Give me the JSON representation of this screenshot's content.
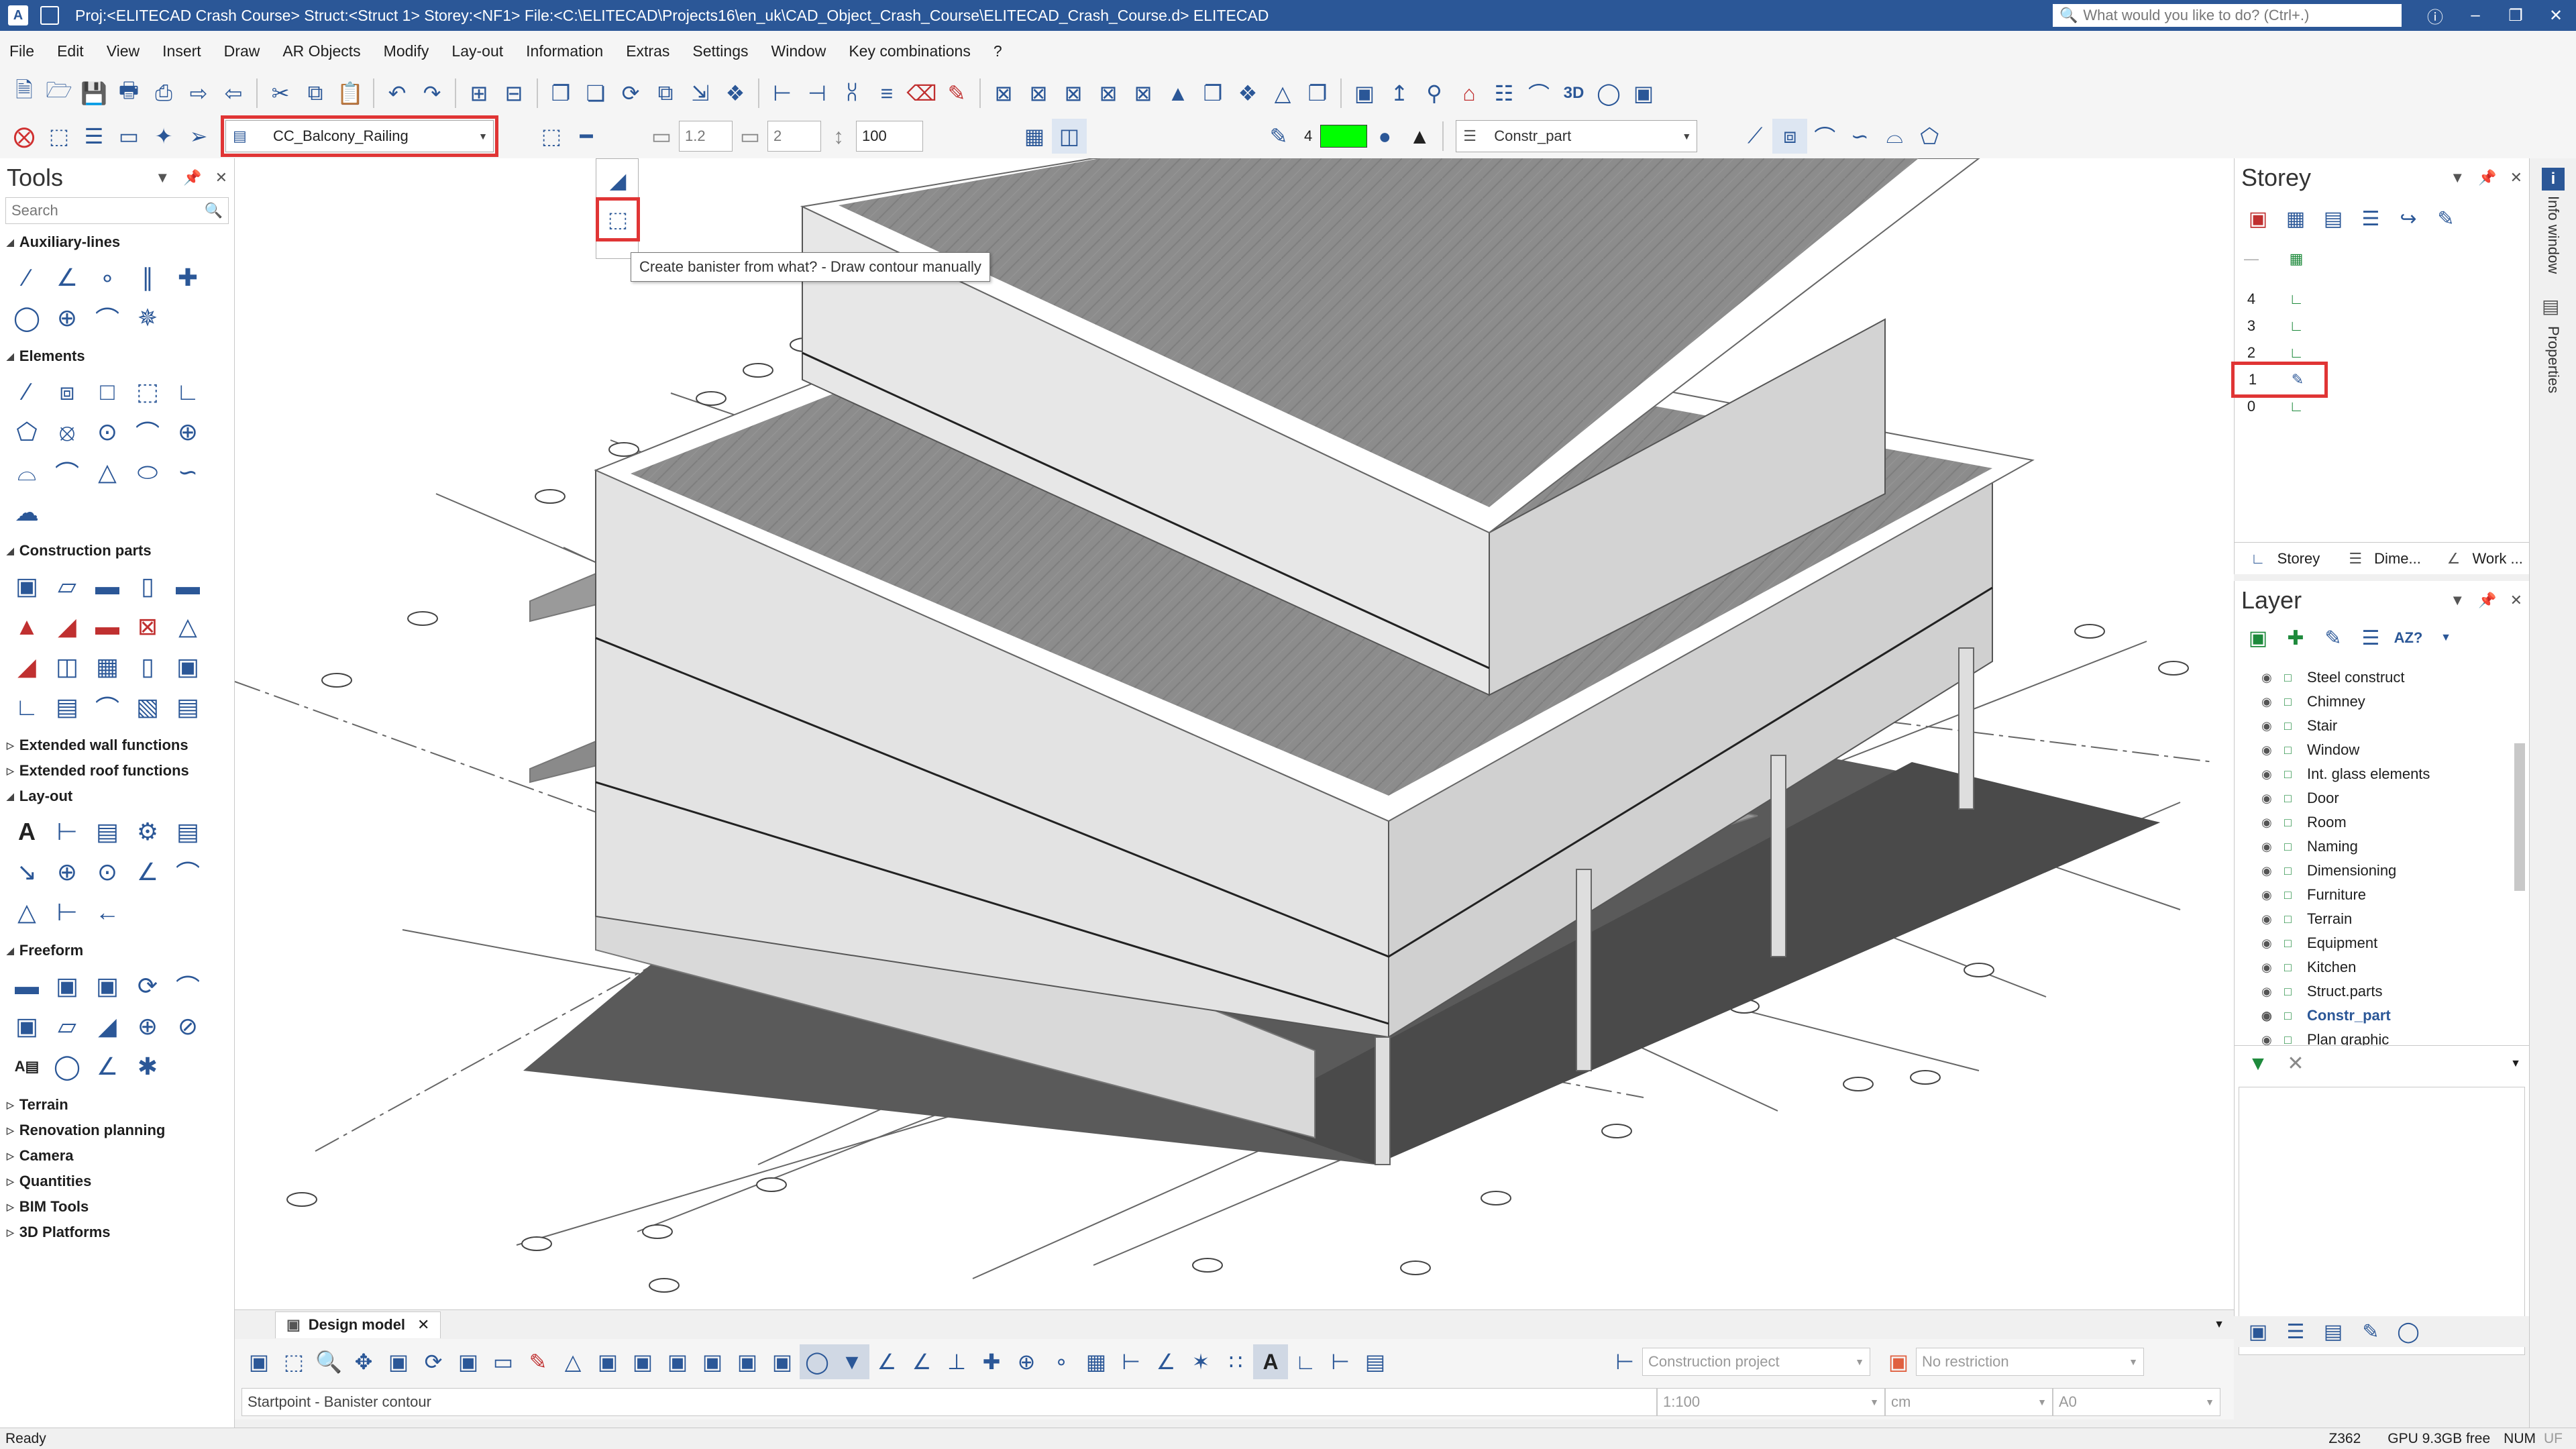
{
  "titlebar": {
    "title": "Proj:<ELITECAD Crash Course>  Struct:<Struct 1>  Storey:<NF1>  File:<C:\\ELITECAD\\Projects16\\en_uk\\CAD_Object_Crash_Course\\ELITECAD_Crash_Course.d>  ELITECAD",
    "search_placeholder": "What would you like to do? (Ctrl+.)",
    "app_letter": "A"
  },
  "menu": [
    "File",
    "Edit",
    "View",
    "Insert",
    "Draw",
    "AR Objects",
    "Modify",
    "Lay-out",
    "Information",
    "Extras",
    "Settings",
    "Window",
    "Key combinations",
    "?"
  ],
  "toolbar2": {
    "object_combo": "CC_Balcony_Railing",
    "field_a": "1.2",
    "field_b": "2",
    "field_c": "100",
    "pen_number": "4",
    "colors": {
      "pen_color": "#00ff00",
      "accent": "#2b5797",
      "highlight": "#e03535"
    },
    "layer_combo": "Constr_part"
  },
  "tooltip": "Create banister from what? - Draw contour manually",
  "tools": {
    "title": "Tools",
    "search_placeholder": "Search",
    "sections": {
      "aux": "Auxiliary-lines",
      "elements": "Elements",
      "construction": "Construction parts",
      "ext_wall": "Extended wall functions",
      "ext_roof": "Extended roof functions",
      "layout": "Lay-out",
      "freeform": "Freeform",
      "terrain": "Terrain",
      "renovation": "Renovation planning",
      "camera": "Camera",
      "quantities": "Quantities",
      "bim": "BIM Tools",
      "platforms": "3D Platforms"
    }
  },
  "tab": {
    "label": "Design model"
  },
  "bottombar": {
    "project_combo": "Construction project",
    "restriction_combo": "No restriction",
    "scale": "1:100",
    "unit": "cm",
    "paper": "A0"
  },
  "command_prompt": "Startpoint - Banister contour",
  "status": {
    "left": "Ready",
    "z": "Z362",
    "gpu": "GPU 9.3GB free",
    "num": "NUM",
    "uf": "UF"
  },
  "storey": {
    "title": "Storey",
    "rows": [
      "4",
      "3",
      "2",
      "1",
      "0"
    ],
    "tabs": [
      "Storey",
      "Dime...",
      "Work ..."
    ]
  },
  "layer": {
    "title": "Layer",
    "items": [
      "Steel construct",
      "Chimney",
      "Stair",
      "Window",
      "Int. glass elements",
      "Door",
      "Room",
      "Naming",
      "Dimensioning",
      "Furniture",
      "Terrain",
      "Equipment",
      "Kitchen",
      "Struct.parts",
      "Constr_part",
      "Plan graphic"
    ],
    "active": "Constr_part"
  },
  "rightstrip": {
    "info": "Info window",
    "props": "Properties"
  }
}
